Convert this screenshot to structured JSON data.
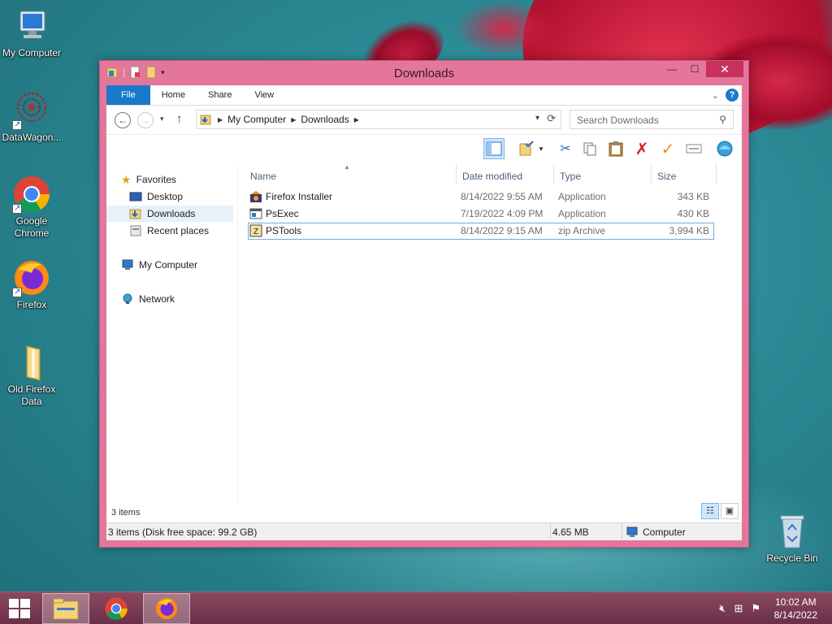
{
  "desktop": {
    "icons": [
      {
        "label": "My Computer"
      },
      {
        "label": "DataWagon..."
      },
      {
        "label": "Google Chrome"
      },
      {
        "label": "Firefox"
      },
      {
        "label": "Old Firefox Data"
      },
      {
        "label": "Recycle Bin"
      }
    ]
  },
  "window": {
    "title": "Downloads",
    "controls": {
      "minimize": "—",
      "maximize": "☐",
      "close": "✕"
    },
    "ribbon_tabs": [
      "File",
      "Home",
      "Share",
      "View"
    ],
    "address": {
      "crumbs": [
        "My Computer",
        "Downloads"
      ],
      "search_placeholder": "Search Downloads"
    },
    "navigation": {
      "favorites": "Favorites",
      "favorite_items": [
        "Desktop",
        "Downloads",
        "Recent places"
      ],
      "computer": "My Computer",
      "network": "Network",
      "selected": "Downloads"
    },
    "columns": [
      "Name",
      "Date modified",
      "Type",
      "Size"
    ],
    "files": [
      {
        "name": "Firefox Installer",
        "date": "8/14/2022 9:55 AM",
        "type": "Application",
        "size": "343 KB"
      },
      {
        "name": "PsExec",
        "date": "7/19/2022 4:09 PM",
        "type": "Application",
        "size": "430 KB"
      },
      {
        "name": "PSTools",
        "date": "8/14/2022 9:15 AM",
        "type": "zip Archive",
        "size": "3,994 KB",
        "selected": true
      }
    ],
    "item_count": "3 items",
    "status": {
      "summary": "3 items (Disk free space: 99.2 GB)",
      "size": "4.65 MB",
      "location": "Computer"
    }
  },
  "taskbar": {
    "clock_time": "10:02 AM",
    "clock_date": "8/14/2022"
  },
  "colors": {
    "window_frame": "#e4769c",
    "file_tab": "#1979ca",
    "close_button": "#c7315a",
    "taskbar": "#7a3c54"
  }
}
